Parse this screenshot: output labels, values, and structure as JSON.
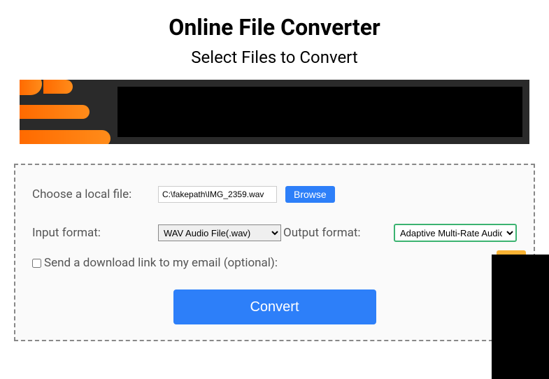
{
  "header": {
    "title": "Online File Converter",
    "subtitle": "Select Files to Convert"
  },
  "form": {
    "choose_file_label": "Choose a local file:",
    "file_value": "C:\\fakepath\\IMG_2359.wav",
    "browse_label": "Browse",
    "input_format_label": "Input format:",
    "input_format_value": "WAV Audio File(.wav)",
    "output_format_label": "Output format:",
    "output_format_value": "Adaptive Multi-Rate Audio F",
    "email_checkbox_label": "Send a download link to my email (optional):",
    "convert_label": "Convert"
  }
}
